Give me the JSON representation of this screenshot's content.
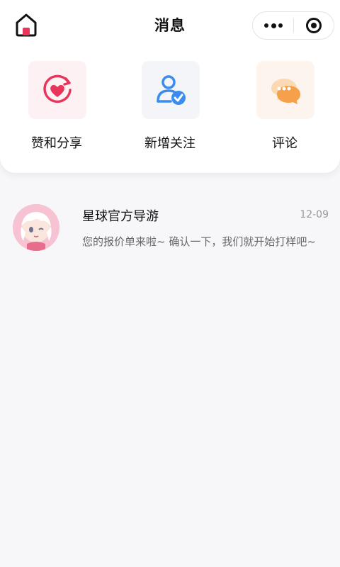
{
  "header": {
    "title": "消息"
  },
  "shortcuts": [
    {
      "label": "赞和分享",
      "icon": "heart-share-icon",
      "color": "#e8365b"
    },
    {
      "label": "新增关注",
      "icon": "user-check-icon",
      "color": "#3a8dee"
    },
    {
      "label": "评论",
      "icon": "comment-icon",
      "color": "#f5a04b"
    }
  ],
  "messages": [
    {
      "name": "星球官方导游",
      "time": "12-09",
      "preview": "您的报价单来啦~ 确认一下，我们就开始打样吧~"
    }
  ]
}
